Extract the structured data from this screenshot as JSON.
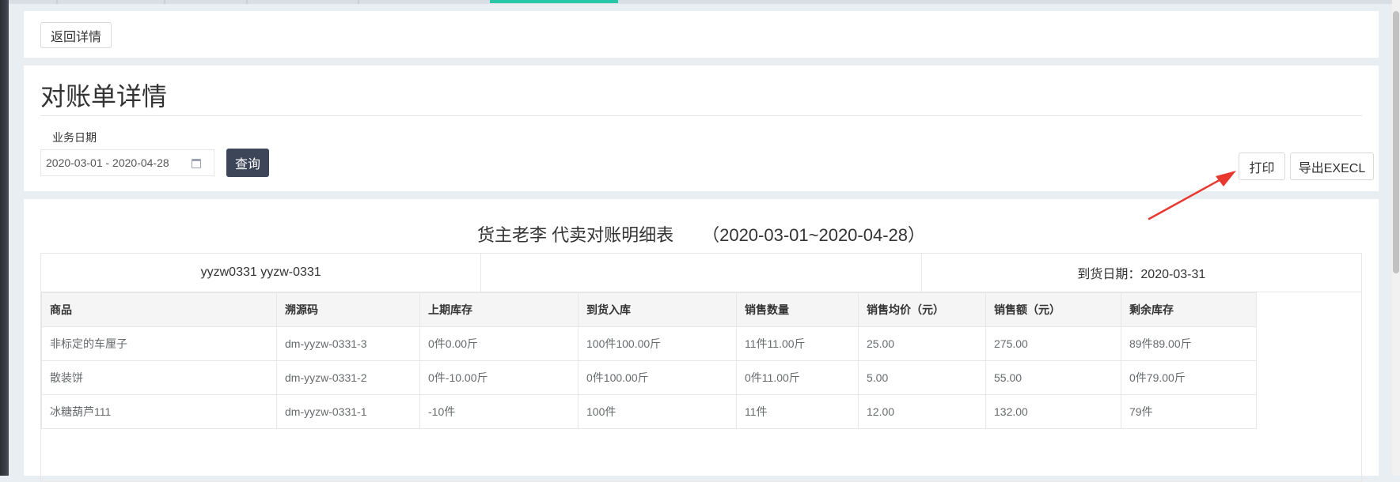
{
  "back": {
    "label": "返回详情"
  },
  "main": {
    "title": "对账单详情",
    "date_label": "业务日期",
    "date_range_value": "2020-03-01 - 2020-04-28",
    "query_label": "查询",
    "print_label": "打印",
    "export_label": "导出EXECL"
  },
  "report": {
    "title_main": "货主老李  代卖对账明细表",
    "title_range": "（2020-03-01~2020-04-28）",
    "info_left": "yyzw0331    yyzw-0331",
    "info_middle": "",
    "info_right": "到货日期：2020-03-31",
    "columns": [
      "商品",
      "溯源码",
      "上期库存",
      "到货入库",
      "销售数量",
      "销售均价（元）",
      "销售额（元）",
      "剩余库存"
    ],
    "rows": [
      [
        "非标定的车厘子",
        "dm-yyzw-0331-3",
        "0件0.00斤",
        "100件100.00斤",
        "11件11.00斤",
        "25.00",
        "275.00",
        "89件89.00斤"
      ],
      [
        "散装饼",
        "dm-yyzw-0331-2",
        "0件-10.00斤",
        "0件100.00斤",
        "0件11.00斤",
        "5.00",
        "55.00",
        "0件79.00斤"
      ],
      [
        "冰糖葫芦111",
        "dm-yyzw-0331-1",
        "-10件",
        "100件",
        "11件",
        "12.00",
        "132.00",
        "79件"
      ]
    ]
  },
  "colors": {
    "accent_tab": "#26c6a6",
    "query_button": "#3d4559",
    "arrow": "#e8382f"
  },
  "icons": {
    "date": "calendar-icon"
  }
}
